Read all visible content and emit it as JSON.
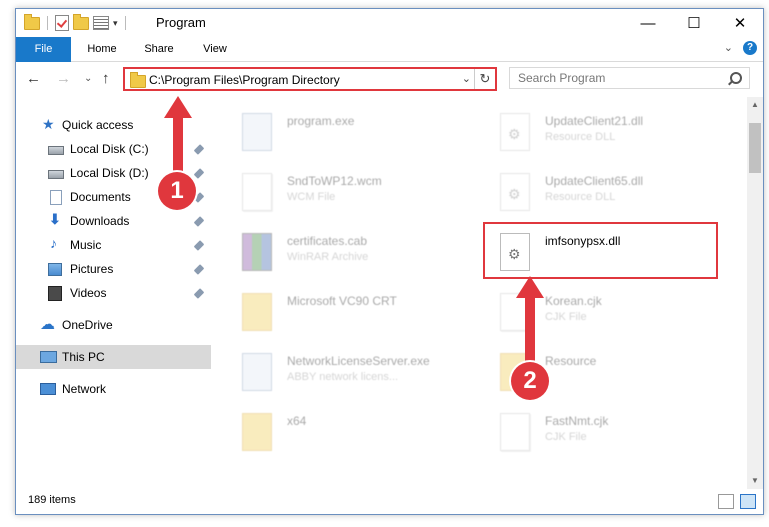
{
  "window": {
    "title": "Program",
    "controls": {
      "minimize": "—",
      "maximize": "☐",
      "close": "✕"
    }
  },
  "ribbon": {
    "tabs": [
      "File",
      "Home",
      "Share",
      "View"
    ],
    "help": "?",
    "expand": "⌄"
  },
  "nav": {
    "back": "←",
    "forward": "→",
    "recent": "⌄",
    "up": "↑",
    "address": "C:\\Program Files\\Program Directory",
    "address_dropdown": "⌄",
    "refresh": "↻",
    "search_placeholder": "Search Program"
  },
  "sidebar": {
    "items": [
      {
        "label": "Quick access",
        "icon": "star-icon",
        "pinned": false
      },
      {
        "label": "Local Disk (C:)",
        "icon": "disk-icon",
        "pinned": true
      },
      {
        "label": "Local Disk (D:)",
        "icon": "disk-icon",
        "pinned": true
      },
      {
        "label": "Documents",
        "icon": "documents-icon",
        "pinned": true
      },
      {
        "label": "Downloads",
        "icon": "downloads-icon",
        "pinned": true
      },
      {
        "label": "Music",
        "icon": "music-icon",
        "pinned": true
      },
      {
        "label": "Pictures",
        "icon": "pictures-icon",
        "pinned": true
      },
      {
        "label": "Videos",
        "icon": "videos-icon",
        "pinned": true
      },
      {
        "label": "OneDrive",
        "icon": "onedrive-icon",
        "pinned": false
      },
      {
        "label": "This PC",
        "icon": "this-pc-icon",
        "pinned": false,
        "selected": true
      },
      {
        "label": "Network",
        "icon": "network-icon",
        "pinned": false
      }
    ]
  },
  "files": {
    "left": [
      {
        "name": "program.exe",
        "type": "",
        "icon": "exe-icon"
      },
      {
        "name": "SndToWP12.wcm",
        "type": "WCM File",
        "icon": "file-icon"
      },
      {
        "name": "certificates.cab",
        "type": "WinRAR Archive",
        "icon": "winrar-icon"
      },
      {
        "name": "Microsoft VC90 CRT",
        "type": "",
        "icon": "folder-icon"
      },
      {
        "name": "NetworkLicenseServer.exe",
        "type": "ABBY network licens...",
        "icon": "exe-icon"
      },
      {
        "name": "x64",
        "type": "",
        "icon": "folder-icon"
      }
    ],
    "right": [
      {
        "name": "UpdateClient21.dll",
        "type": "Resource DLL",
        "icon": "dll-icon"
      },
      {
        "name": "UpdateClient65.dll",
        "type": "Resource DLL",
        "icon": "dll-icon"
      },
      {
        "name": "imfsonypsx.dll",
        "type": "",
        "icon": "dll-icon",
        "highlighted": true
      },
      {
        "name": "Korean.cjk",
        "type": "CJK File",
        "icon": "file-icon"
      },
      {
        "name": "Resource",
        "type": "",
        "icon": "folder-icon"
      },
      {
        "name": "FastNmt.cjk",
        "type": "CJK File",
        "icon": "file-icon"
      }
    ]
  },
  "annotations": {
    "step1": "1",
    "step2": "2",
    "color": "#e0373d"
  },
  "status": {
    "item_count": "189 items"
  },
  "colors": {
    "accent": "#1979ca",
    "highlight": "#e0373d",
    "selected_bg": "#d9d9d9"
  }
}
